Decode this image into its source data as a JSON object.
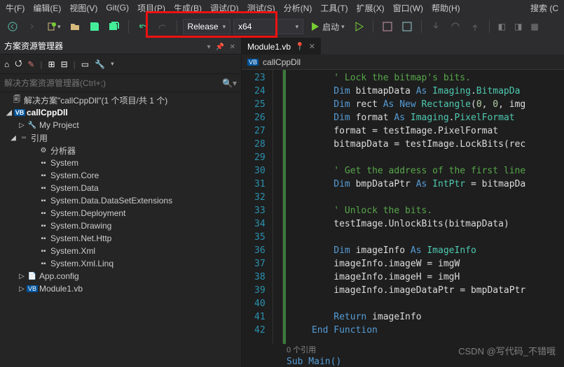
{
  "menu": {
    "file": "牛(F)",
    "edit": "编辑(E)",
    "view": "视图(V)",
    "git": "Git(G)",
    "project": "项目(P)",
    "build": "生成(B)",
    "debug": "调试(D)",
    "test": "测试(S)",
    "analyze": "分析(N)",
    "tools": "工具(T)",
    "ext": "扩展(X)",
    "window": "窗口(W)",
    "help": "帮助(H)",
    "search": "搜索 (C"
  },
  "toolbar": {
    "config": "Release",
    "platform": "x64",
    "start": "启动"
  },
  "explorer": {
    "title": "方案资源管理器",
    "searchPlaceholder": "解决方案资源管理器(Ctrl+;)",
    "solution": "解决方案\"callCppDll\"(1 个项目/共 1 个)",
    "project": "callCppDll",
    "myproject": "My Project",
    "refs": "引用",
    "items": [
      "分析器",
      "System",
      "System.Core",
      "System.Data",
      "System.Data.DataSetExtensions",
      "System.Deployment",
      "System.Drawing",
      "System.Net.Http",
      "System.Xml",
      "System.Xml.Linq"
    ],
    "appconfig": "App.config",
    "module": "Module1.vb"
  },
  "editor": {
    "tab": "Module1.vb",
    "crumb": "callCppDll",
    "lineStart": 23,
    "lines": [
      [
        [
          "cm",
          "' Lock the bitmap's bits."
        ]
      ],
      [
        [
          "kw",
          "Dim "
        ],
        [
          "id",
          "bitmapData "
        ],
        [
          "kw",
          "As "
        ],
        [
          "ty",
          "Imaging"
        ],
        [
          "op",
          "."
        ],
        [
          "ty",
          "BitmapDa"
        ]
      ],
      [
        [
          "kw",
          "Dim "
        ],
        [
          "id",
          "rect "
        ],
        [
          "kw",
          "As New "
        ],
        [
          "ty",
          "Rectangle"
        ],
        [
          "op",
          "("
        ],
        [
          "nu",
          "0"
        ],
        [
          "op",
          ", "
        ],
        [
          "nu",
          "0"
        ],
        [
          "op",
          ", img"
        ]
      ],
      [
        [
          "kw",
          "Dim "
        ],
        [
          "id",
          "format "
        ],
        [
          "kw",
          "As "
        ],
        [
          "ty",
          "Imaging"
        ],
        [
          "op",
          "."
        ],
        [
          "ty",
          "PixelFormat"
        ]
      ],
      [
        [
          "id",
          "format "
        ],
        [
          "op",
          "= "
        ],
        [
          "id",
          "testImage"
        ],
        [
          "op",
          "."
        ],
        [
          "id",
          "PixelFormat"
        ]
      ],
      [
        [
          "id",
          "bitmapData "
        ],
        [
          "op",
          "= "
        ],
        [
          "id",
          "testImage"
        ],
        [
          "op",
          "."
        ],
        [
          "id",
          "LockBits"
        ],
        [
          "op",
          "("
        ],
        [
          "id",
          "rec"
        ]
      ],
      [],
      [
        [
          "cm",
          "' Get the address of the first line"
        ]
      ],
      [
        [
          "kw",
          "Dim "
        ],
        [
          "id",
          "bmpDataPtr "
        ],
        [
          "kw",
          "As "
        ],
        [
          "ty",
          "IntPtr"
        ],
        [
          "op",
          " = "
        ],
        [
          "id",
          "bitmapDa"
        ]
      ],
      [],
      [
        [
          "cm",
          "' Unlock the bits."
        ]
      ],
      [
        [
          "id",
          "testImage"
        ],
        [
          "op",
          "."
        ],
        [
          "id",
          "UnlockBits"
        ],
        [
          "op",
          "("
        ],
        [
          "id",
          "bitmapData"
        ],
        [
          "op",
          ")"
        ]
      ],
      [],
      [
        [
          "kw",
          "Dim "
        ],
        [
          "id",
          "imageInfo "
        ],
        [
          "kw",
          "As "
        ],
        [
          "ty",
          "ImageInfo"
        ]
      ],
      [
        [
          "id",
          "imageInfo"
        ],
        [
          "op",
          "."
        ],
        [
          "id",
          "imageW "
        ],
        [
          "op",
          "= "
        ],
        [
          "id",
          "imgW"
        ]
      ],
      [
        [
          "id",
          "imageInfo"
        ],
        [
          "op",
          "."
        ],
        [
          "id",
          "imageH "
        ],
        [
          "op",
          "= "
        ],
        [
          "id",
          "imgH"
        ]
      ],
      [
        [
          "id",
          "imageInfo"
        ],
        [
          "op",
          "."
        ],
        [
          "id",
          "imageDataPtr "
        ],
        [
          "op",
          "= "
        ],
        [
          "id",
          "bmpDataPtr"
        ]
      ],
      [],
      [
        [
          "kw",
          "Return "
        ],
        [
          "id",
          "imageInfo"
        ]
      ],
      [
        [
          "kw",
          "End Function"
        ]
      ]
    ],
    "refsText": "0 个引用",
    "subMain": "Sub Main()"
  },
  "watermark": "CSDN @写代码_不错哦"
}
